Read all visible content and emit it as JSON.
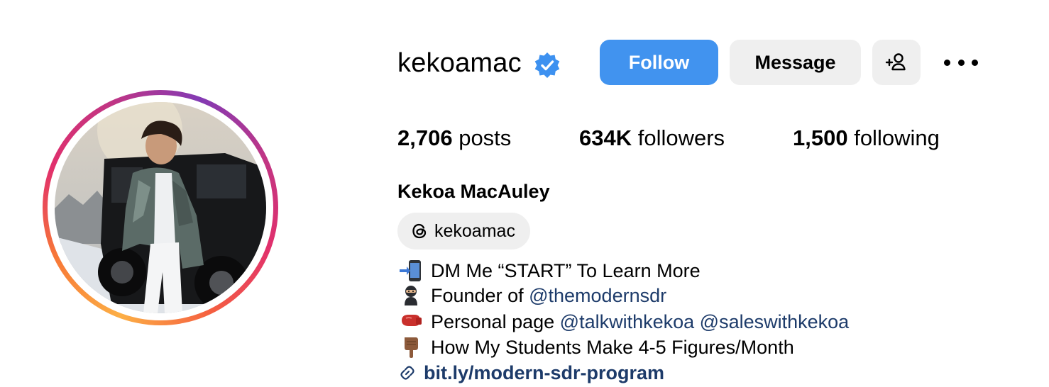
{
  "profile": {
    "username": "kekoamac",
    "verified": true,
    "full_name": "Kekoa MacAuley",
    "threads_handle": "kekoamac"
  },
  "actions": {
    "follow_label": "Follow",
    "message_label": "Message"
  },
  "stats": {
    "posts_count": "2,706",
    "posts_label": "posts",
    "followers_count": "634K",
    "followers_label": "followers",
    "following_count": "1,500",
    "following_label": "following"
  },
  "bio": {
    "line1": "DM Me “START” To Learn More",
    "line2_text": "Founder of",
    "line2_mention": "@themodernsdr",
    "line3_text": "Personal page",
    "line3_mention1": "@talkwithkekoa",
    "line3_mention2": "@saleswithkekoa",
    "line4": "How My Students Make 4-5 Figures/Month",
    "link": "bit.ly/modern-sdr-program"
  },
  "icons": {
    "verified": "verified-badge-icon",
    "add_user": "add-user-icon",
    "more": "more-options-icon",
    "threads": "threads-icon",
    "link": "link-icon",
    "emoji1": "mobile-arrow-emoji",
    "emoji2": "ninja-emoji",
    "emoji3": "boxing-glove-emoji",
    "emoji4": "pointing-down-emoji"
  },
  "colors": {
    "follow_button": "#4193ef",
    "secondary_button": "#efefef",
    "mention": "#1d3b6a",
    "verified_badge": "#3d91f0"
  }
}
